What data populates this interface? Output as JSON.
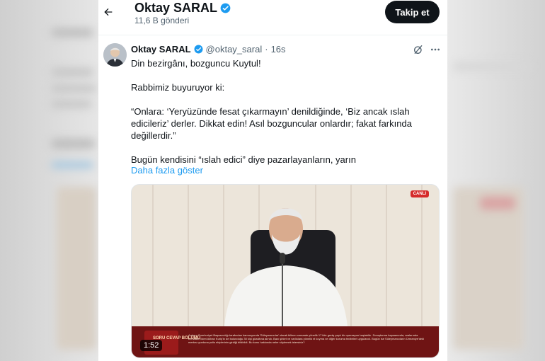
{
  "header": {
    "title": "Oktay SARAL",
    "post_count": "11,6 B gönderi",
    "follow_label": "Takip et"
  },
  "tweet": {
    "author_name": "Oktay SARAL",
    "handle": "@oktay_saral",
    "separator": "·",
    "time": "16s",
    "lines": [
      "Din bezirgânı, bozguncu Kuytul!",
      "Rabbimiz buyuruyor ki:",
      "“Onlara: ‘Yeryüzünde fesat çıkarmayın’ denildiğinde, ‘Biz ancak ıslah edicileriz’ derler. Dikkat edin! Asıl bozguncular onlardır; fakat farkında değillerdir.”",
      "Bugün kendisini “ıslah edici” diye pazarlayanların, yarın"
    ],
    "show_more": "Daha fazla göster"
  },
  "media": {
    "live_badge": "CANLI",
    "duration": "1:52",
    "ticker_label": "SORU CEVAP BÖLÜMÜ",
    "ticker_text": "Ankara Cumhuriyet Başsavcılığı tarafından kamuoyunda 'Süleymancılar' olarak bilinen cemaate yönelik 17 ilde geniş çaplı bir operasyon başlatıldı. Soruşturma kapsamında, aralarında cemaatin lideri Alihan Kuriş'in de bulunduğu 30 kişi gözaltına alındı. Bazı şirket ve varlıklara yönelik el koyma ve diğer koruma tedbirleri uygulandı. Bugün ise Süleymancıların Ümraniye'deki merkez yurduna polis ekiplerinin girdiği bildirildi. Bu konu hakkında neler söylemek istersiniz?"
  },
  "colors": {
    "accent": "#1d9bf0",
    "verified": "#1d9bf0",
    "follow_bg": "#0f1419"
  }
}
